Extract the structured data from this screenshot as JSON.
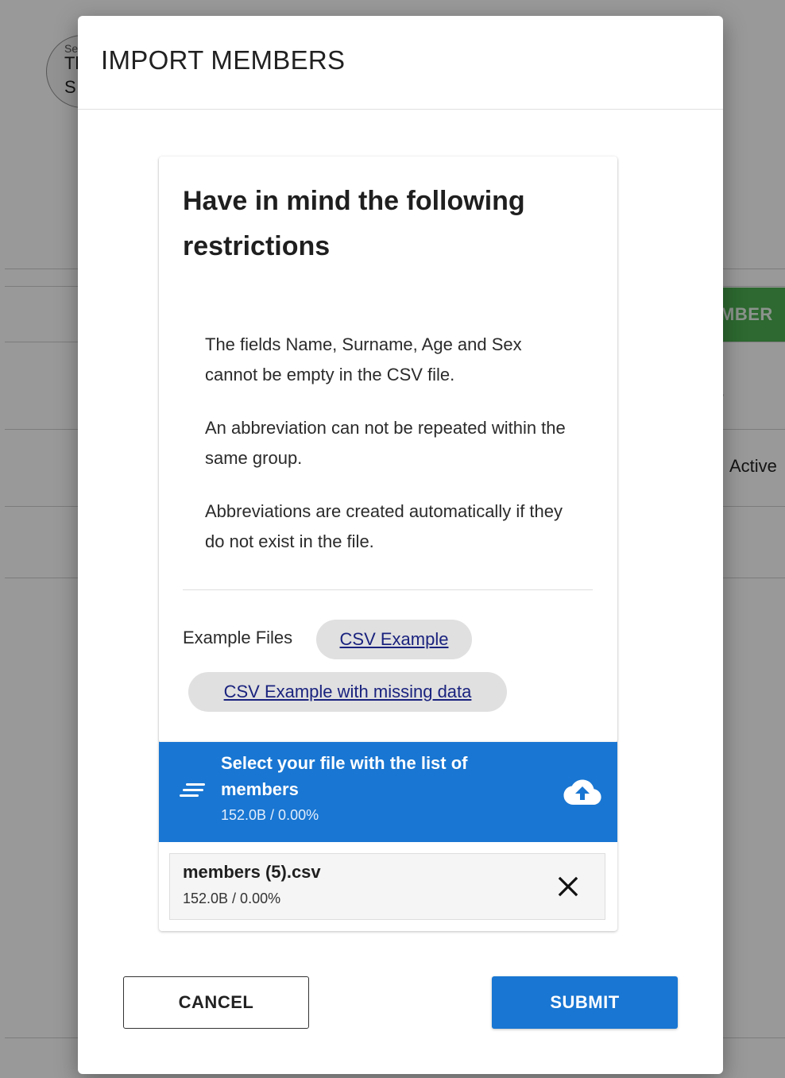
{
  "background": {
    "avatar_small": "Se",
    "avatar_line1": "Tl",
    "avatar_line2": "S",
    "green_button_label": "MBER",
    "status_text": "Active"
  },
  "modal": {
    "title": "IMPORT MEMBERS",
    "restrictions": {
      "title": "Have in mind the following restrictions",
      "rules": [
        "The fields Name, Surname, Age and Sex cannot be empty in the CSV file.",
        "An abbreviation can not be repeated within the same group.",
        "Abbreviations are created automatically if they do not exist in the file."
      ],
      "examples_label": "Example Files",
      "example_links": [
        "CSV Example",
        "CSV Example with missing data"
      ]
    },
    "upload": {
      "title": "Select your file with the list of members",
      "progress": "152.0B / 0.00%",
      "file": {
        "name": "members (5).csv",
        "progress": "152.0B / 0.00%"
      }
    },
    "actions": {
      "cancel_label": "CANCEL",
      "submit_label": "SUBMIT"
    }
  },
  "colors": {
    "primary": "#1976d2",
    "success": "#4caf50",
    "chip": "#e0e0e0"
  },
  "icons": {
    "upload_list": "list-lines-icon",
    "upload_action": "cloud-upload-icon",
    "remove_file": "close-icon"
  }
}
